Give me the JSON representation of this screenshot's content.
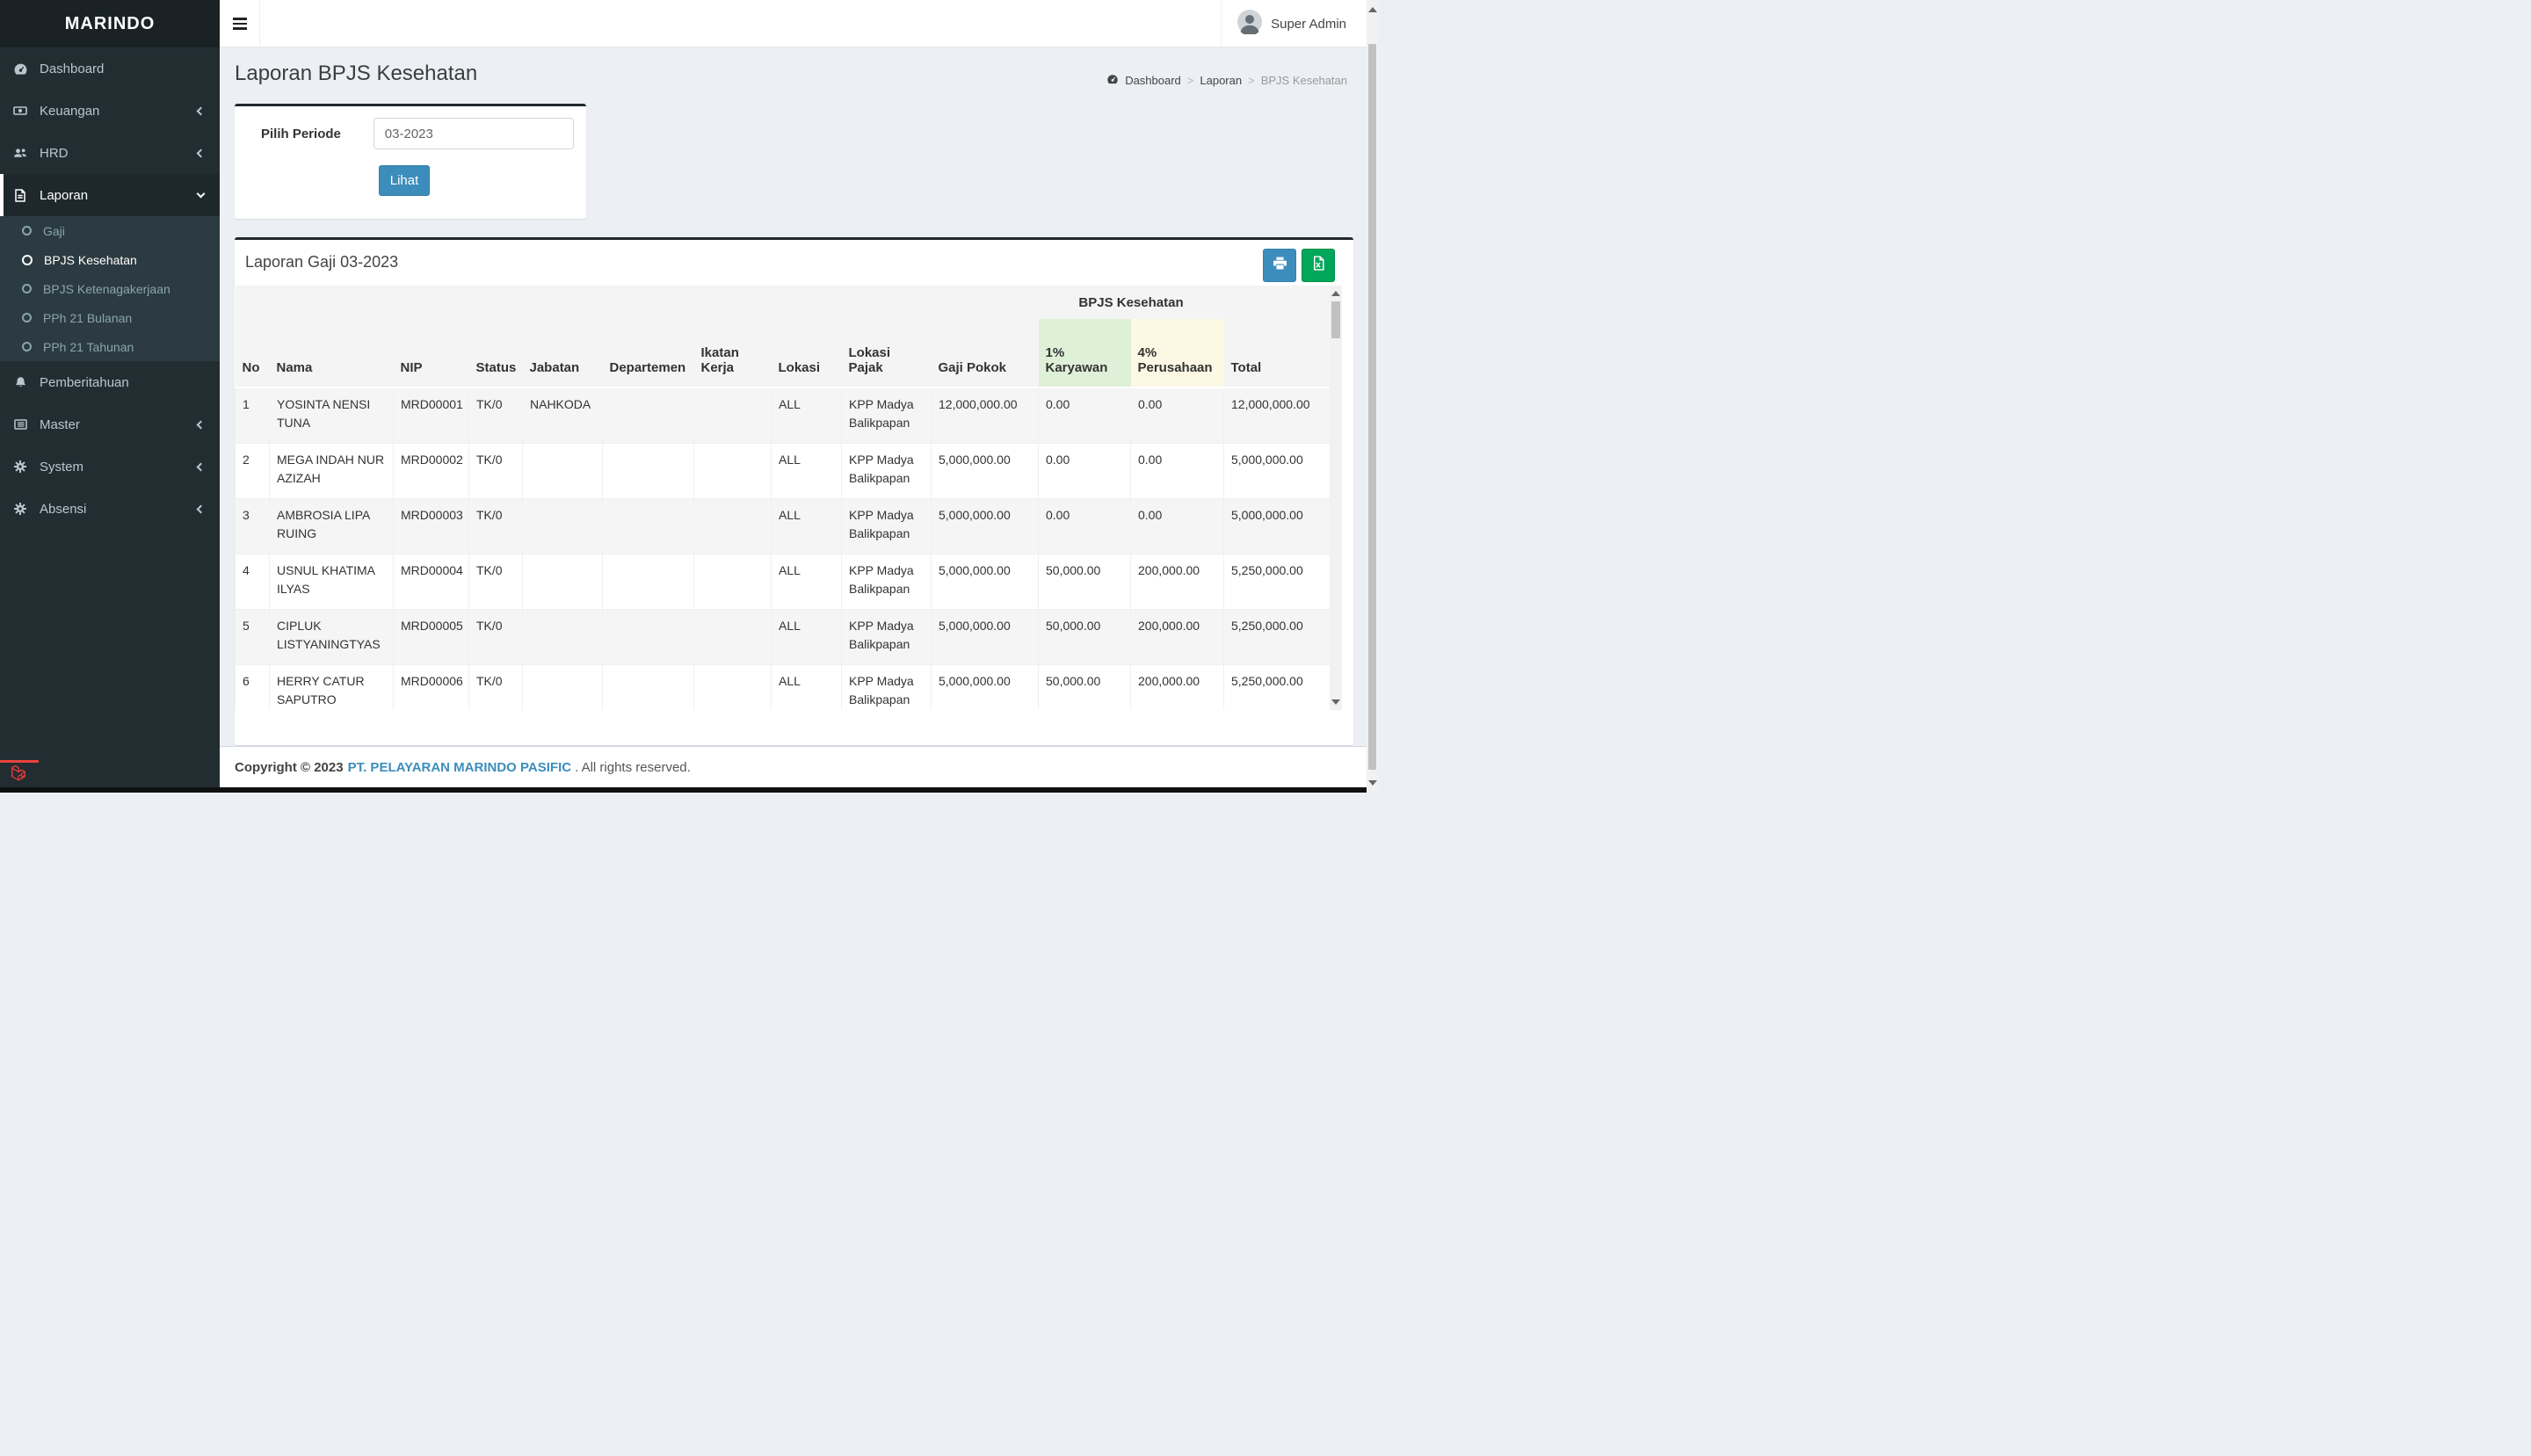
{
  "brand": "MARINDO",
  "topbar": {
    "user": "Super Admin"
  },
  "sidebar": {
    "items": [
      {
        "label": "Dashboard",
        "icon": "gauge-icon",
        "chevron": false,
        "active": false
      },
      {
        "label": "Keuangan",
        "icon": "money-icon",
        "chevron": true,
        "active": false
      },
      {
        "label": "HRD",
        "icon": "users-icon",
        "chevron": true,
        "active": false
      },
      {
        "label": "Laporan",
        "icon": "file-icon",
        "chevron": "down",
        "active": true,
        "children": [
          {
            "label": "Gaji",
            "active": false
          },
          {
            "label": "BPJS Kesehatan",
            "active": true
          },
          {
            "label": "BPJS Ketenagakerjaan",
            "active": false
          },
          {
            "label": "PPh 21 Bulanan",
            "active": false
          },
          {
            "label": "PPh 21 Tahunan",
            "active": false
          }
        ]
      },
      {
        "label": "Pemberitahuan",
        "icon": "bell-icon",
        "chevron": false,
        "active": false
      },
      {
        "label": "Master",
        "icon": "list-icon",
        "chevron": true,
        "active": false
      },
      {
        "label": "System",
        "icon": "gear-icon",
        "chevron": true,
        "active": false
      },
      {
        "label": "Absensi",
        "icon": "gear-icon",
        "chevron": true,
        "active": false
      }
    ]
  },
  "page": {
    "title": "Laporan BPJS Kesehatan",
    "breadcrumb": [
      "Dashboard",
      "Laporan",
      "BPJS Kesehatan"
    ]
  },
  "filter": {
    "label": "Pilih Periode",
    "value": "03-2023",
    "button": "Lihat"
  },
  "report": {
    "title": "Laporan Gaji 03-2023",
    "group_header": "BPJS Kesehatan",
    "columns": [
      "No",
      "Nama",
      "NIP",
      "Status",
      "Jabatan",
      "Departemen",
      "Ikatan Kerja",
      "Lokasi",
      "Lokasi Pajak",
      "Gaji Pokok",
      "1% Karyawan",
      "4% Perusahaan",
      "Total"
    ],
    "rows": [
      [
        "1",
        "YOSINTA NENSI TUNA",
        "MRD00001",
        "TK/0",
        "NAHKODA",
        "",
        "",
        "ALL",
        "KPP Madya Balikpapan",
        "12,000,000.00",
        "0.00",
        "0.00",
        "12,000,000.00"
      ],
      [
        "2",
        "MEGA INDAH NUR AZIZAH",
        "MRD00002",
        "TK/0",
        "",
        "",
        "",
        "ALL",
        "KPP Madya Balikpapan",
        "5,000,000.00",
        "0.00",
        "0.00",
        "5,000,000.00"
      ],
      [
        "3",
        "AMBROSIA LIPA RUING",
        "MRD00003",
        "TK/0",
        "",
        "",
        "",
        "ALL",
        "KPP Madya Balikpapan",
        "5,000,000.00",
        "0.00",
        "0.00",
        "5,000,000.00"
      ],
      [
        "4",
        "USNUL KHATIMA ILYAS",
        "MRD00004",
        "TK/0",
        "",
        "",
        "",
        "ALL",
        "KPP Madya Balikpapan",
        "5,000,000.00",
        "50,000.00",
        "200,000.00",
        "5,250,000.00"
      ],
      [
        "5",
        "CIPLUK LISTYANINGTYAS",
        "MRD00005",
        "TK/0",
        "",
        "",
        "",
        "ALL",
        "KPP Madya Balikpapan",
        "5,000,000.00",
        "50,000.00",
        "200,000.00",
        "5,250,000.00"
      ],
      [
        "6",
        "HERRY CATUR SAPUTRO",
        "MRD00006",
        "TK/0",
        "",
        "",
        "",
        "ALL",
        "KPP Madya Balikpapan",
        "5,000,000.00",
        "50,000.00",
        "200,000.00",
        "5,250,000.00"
      ]
    ]
  },
  "footer": {
    "copyright_prefix": "Copyright © 2023",
    "company": "PT. PELAYARAN MARINDO PASIFIC",
    "suffix": ". All rights reserved."
  },
  "colors": {
    "primary": "#3c8dbc",
    "success": "#00a65a",
    "sidebar": "#222d32",
    "karyawan_header_bg": "#dff0d8",
    "perusahaan_header_bg": "#fcf8e3",
    "debug_accent": "#e9433c"
  }
}
